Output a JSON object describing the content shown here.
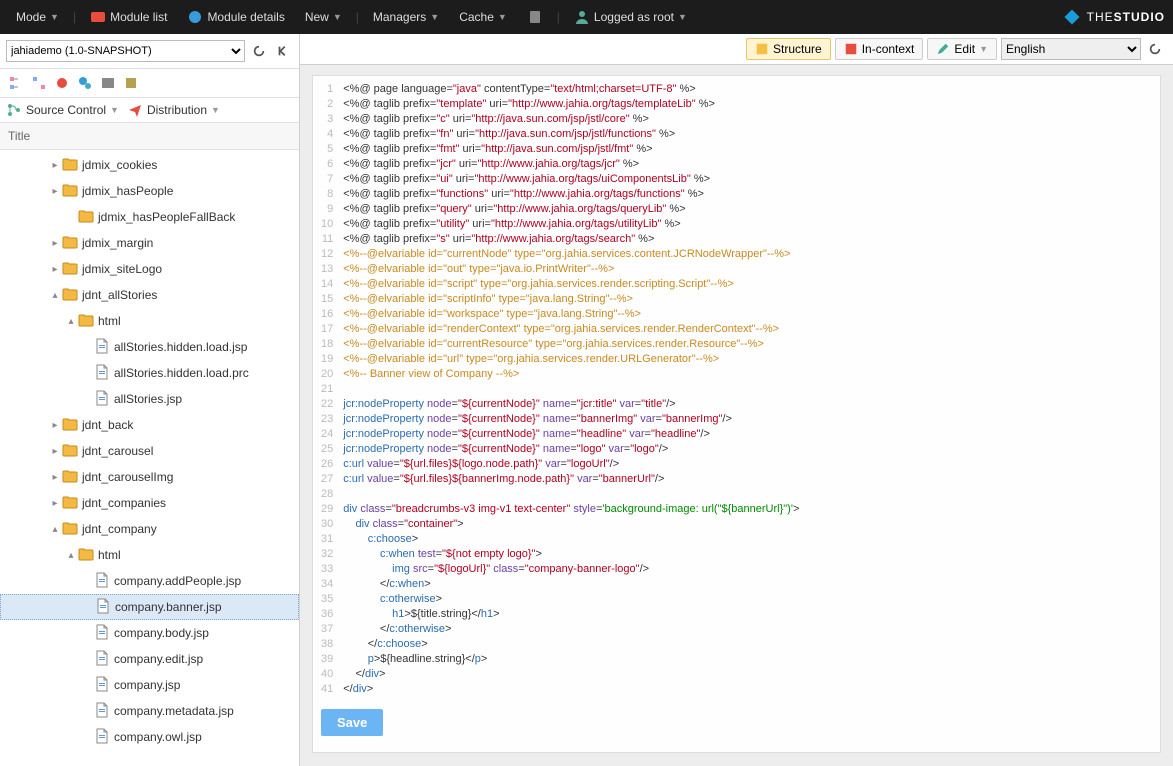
{
  "topbar": {
    "mode": "Mode",
    "module_list": "Module list",
    "module_details": "Module details",
    "new": "New",
    "managers": "Managers",
    "cache": "Cache",
    "logged_as": "Logged as root",
    "brand_prefix": "THE",
    "brand_suffix": "STUDIO"
  },
  "left": {
    "module_selected": "jahiademo (1.0-SNAPSHOT)",
    "source_control": "Source Control",
    "distribution": "Distribution",
    "col_title": "Title"
  },
  "tree": [
    {
      "depth": 3,
      "exp": "▸",
      "icon": "folder",
      "label": "jdmix_cookies"
    },
    {
      "depth": 3,
      "exp": "▸",
      "icon": "folder",
      "label": "jdmix_hasPeople"
    },
    {
      "depth": 4,
      "exp": "",
      "icon": "folder",
      "label": "jdmix_hasPeopleFallBack"
    },
    {
      "depth": 3,
      "exp": "▸",
      "icon": "folder",
      "label": "jdmix_margin"
    },
    {
      "depth": 3,
      "exp": "▸",
      "icon": "folder",
      "label": "jdmix_siteLogo"
    },
    {
      "depth": 3,
      "exp": "▴",
      "icon": "folder",
      "label": "jdnt_allStories"
    },
    {
      "depth": 4,
      "exp": "▴",
      "icon": "folder",
      "label": "html"
    },
    {
      "depth": 5,
      "exp": "",
      "icon": "file",
      "label": "allStories.hidden.load.jsp"
    },
    {
      "depth": 5,
      "exp": "",
      "icon": "file",
      "label": "allStories.hidden.load.prc"
    },
    {
      "depth": 5,
      "exp": "",
      "icon": "file",
      "label": "allStories.jsp"
    },
    {
      "depth": 3,
      "exp": "▸",
      "icon": "folder",
      "label": "jdnt_back"
    },
    {
      "depth": 3,
      "exp": "▸",
      "icon": "folder",
      "label": "jdnt_carousel"
    },
    {
      "depth": 3,
      "exp": "▸",
      "icon": "folder",
      "label": "jdnt_carouselImg"
    },
    {
      "depth": 3,
      "exp": "▸",
      "icon": "folder",
      "label": "jdnt_companies"
    },
    {
      "depth": 3,
      "exp": "▴",
      "icon": "folder",
      "label": "jdnt_company"
    },
    {
      "depth": 4,
      "exp": "▴",
      "icon": "folder",
      "label": "html"
    },
    {
      "depth": 5,
      "exp": "",
      "icon": "file",
      "label": "company.addPeople.jsp"
    },
    {
      "depth": 5,
      "exp": "",
      "icon": "file",
      "label": "company.banner.jsp",
      "selected": true
    },
    {
      "depth": 5,
      "exp": "",
      "icon": "file",
      "label": "company.body.jsp"
    },
    {
      "depth": 5,
      "exp": "",
      "icon": "file",
      "label": "company.edit.jsp"
    },
    {
      "depth": 5,
      "exp": "",
      "icon": "file",
      "label": "company.jsp"
    },
    {
      "depth": 5,
      "exp": "",
      "icon": "file",
      "label": "company.metadata.jsp"
    },
    {
      "depth": 5,
      "exp": "",
      "icon": "file",
      "label": "company.owl.jsp"
    }
  ],
  "right": {
    "structure": "Structure",
    "in_context": "In-context",
    "edit": "Edit",
    "language": "English",
    "save": "Save"
  },
  "code_lines": [
    "<%@ page language=<q>java</q> contentType=<q>text/html;charset=UTF-8</q> %>",
    "<%@ taglib prefix=<q>template</q> uri=<q>http://www.jahia.org/tags/templateLib</q> %>",
    "<%@ taglib prefix=<q>c</q> uri=<q>http://java.sun.com/jsp/jstl/core</q> %>",
    "<%@ taglib prefix=<q>fn</q> uri=<q>http://java.sun.com/jsp/jstl/functions</q> %>",
    "<%@ taglib prefix=<q>fmt</q> uri=<q>http://java.sun.com/jsp/jstl/fmt</q> %>",
    "<%@ taglib prefix=<q>jcr</q> uri=<q>http://www.jahia.org/tags/jcr</q> %>",
    "<%@ taglib prefix=<q>ui</q> uri=<q>http://www.jahia.org/tags/uiComponentsLib</q> %>",
    "<%@ taglib prefix=<q>functions</q> uri=<q>http://www.jahia.org/tags/functions</q> %>",
    "<%@ taglib prefix=<q>query</q> uri=<q>http://www.jahia.org/tags/queryLib</q> %>",
    "<%@ taglib prefix=<q>utility</q> uri=<q>http://www.jahia.org/tags/utilityLib</q> %>",
    "<%@ taglib prefix=<q>s</q> uri=<q>http://www.jahia.org/tags/search</q> %>",
    "<c><%--@elvariable id=\"currentNode\" type=\"org.jahia.services.content.JCRNodeWrapper\"--%></c>",
    "<c><%--@elvariable id=\"out\" type=\"java.io.PrintWriter\"--%></c>",
    "<c><%--@elvariable id=\"script\" type=\"org.jahia.services.render.scripting.Script\"--%></c>",
    "<c><%--@elvariable id=\"scriptInfo\" type=\"java.lang.String\"--%></c>",
    "<c><%--@elvariable id=\"workspace\" type=\"java.lang.String\"--%></c>",
    "<c><%--@elvariable id=\"renderContext\" type=\"org.jahia.services.render.RenderContext\"--%></c>",
    "<c><%--@elvariable id=\"currentResource\" type=\"org.jahia.services.render.Resource\"--%></c>",
    "<c><%--@elvariable id=\"url\" type=\"org.jahia.services.render.URLGenerator\"--%></c>",
    "<c><%-- Banner view of Company --%></c>",
    "",
    "<t>jcr:nodeProperty</t> <a>node</a>=<q>${currentNode}</q> <a>name</a>=<q>jcr:title</q> <a>var</a>=<q>title</q>/>",
    "<t>jcr:nodeProperty</t> <a>node</a>=<q>${currentNode}</q> <a>name</a>=<q>bannerImg</q> <a>var</a>=<q>bannerImg</q>/>",
    "<t>jcr:nodeProperty</t> <a>node</a>=<q>${currentNode}</q> <a>name</a>=<q>headline</q> <a>var</a>=<q>headline</q>/>",
    "<t>jcr:nodeProperty</t> <a>node</a>=<q>${currentNode}</q> <a>name</a>=<q>logo</q> <a>var</a>=<q>logo</q>/>",
    "<t>c:url</t> <a>value</a>=<q>${url.files}${logo.node.path}</q> <a>var</a>=<q>logoUrl</q>/>",
    "<t>c:url</t> <a>value</a>=<q>${url.files}${bannerImg.node.path}</q> <a>var</a>=<q>bannerUrl</q>/>",
    "",
    "<t>div</t> <a>class</a>=<q>breadcrumbs-v3 img-v1 text-center</q> <a>style</a>=<g>'background-image: url(\"${bannerUrl}\")'</g>>",
    "    <t>div</t> <a>class</a>=<q>container</q>>",
    "        <t>c:choose</t>>",
    "            <t>c:when</t> <a>test</a>=<q>${not empty logo}</q>>",
    "                <t>img</t> <a>src</a>=<q>${logoUrl}</q> <a>class</a>=<q>company-banner-logo</q>/>",
    "            </<t>c:when</t>>",
    "            <t>c:otherwise</t>>",
    "                <t>h1</t>>${title.string}</<t>h1</t>>",
    "            </<t>c:otherwise</t>>",
    "        </<t>c:choose</t>>",
    "        <t>p</t>>${headline.string}</<t>p</t>>",
    "    </<t>div</t>>",
    "</<t>div</t>>"
  ]
}
